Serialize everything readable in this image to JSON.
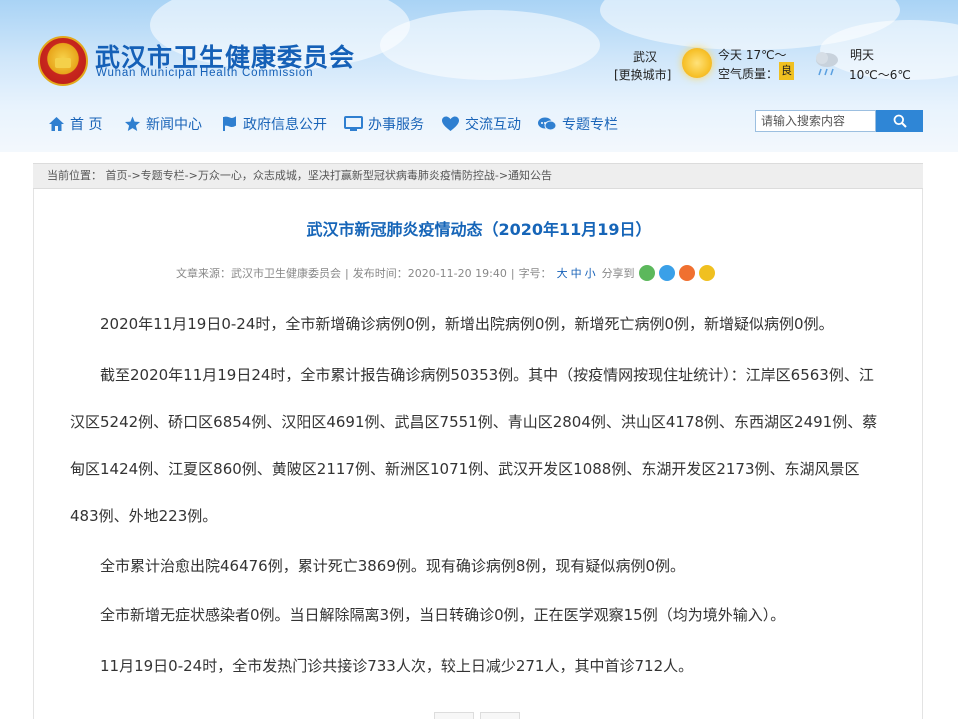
{
  "site": {
    "title": "武汉市卫生健康委员会",
    "subtitle": "Wuhan Municipal Health Commission"
  },
  "weather": {
    "city": "武汉",
    "switch_city": "[更换城市]",
    "today": "今天 17℃～",
    "aqi_label": "空气质量：",
    "aqi_value": "良",
    "tomorrow_label": "明天",
    "tomorrow_temp": "10℃～6℃",
    "colors": {
      "aqi_badge": "#f0c020"
    }
  },
  "nav": {
    "items": [
      {
        "label": "首 页",
        "icon": "home-icon"
      },
      {
        "label": "新闻中心",
        "icon": "star-icon"
      },
      {
        "label": "政府信息公开",
        "icon": "flag-icon"
      },
      {
        "label": "办事服务",
        "icon": "monitor-icon"
      },
      {
        "label": "交流互动",
        "icon": "heart-icon"
      },
      {
        "label": "专题专栏",
        "icon": "chat-icon"
      }
    ]
  },
  "search": {
    "placeholder": "请输入搜索内容",
    "button_icon": "search-icon"
  },
  "breadcrumb": {
    "text": "当前位置： 首页->专题专栏->万众一心，众志成城，坚决打赢新型冠状病毒肺炎疫情防控战->通知公告"
  },
  "article": {
    "title": "武汉市新冠肺炎疫情动态（2020年11月19日）",
    "meta": {
      "source_label": "文章来源：",
      "source": "武汉市卫生健康委员会",
      "sep": "|",
      "time_label": "发布时间：",
      "time": "2020-11-20 19:40",
      "size_label": "字号：",
      "size_large": "大",
      "size_medium": "中",
      "size_small": "小",
      "share_label": "分享到"
    },
    "paragraphs": {
      "p1": "2020年11月19日0-24时，全市新增确诊病例0例，新增出院病例0例，新增死亡病例0例，新增疑似病例0例。",
      "p2": "截至2020年11月19日24时，全市累计报告确诊病例50353例。其中（按疫情网按现住址统计）：江岸区6563例、江汉区5242例、硚口区6854例、汉阳区4691例、武昌区7551例、青山区2804例、洪山区4178例、东西湖区2491例、蔡甸区1424例、江夏区860例、黄陂区2117例、新洲区1071例、武汉开发区1088例、东湖开发区2173例、东湖风景区483例、外地223例。",
      "p3": "全市累计治愈出院46476例，累计死亡3869例。现有确诊病例8例，现有疑似病例0例。",
      "p4": "全市新增无症状感染者0例。当日解除隔离3例，当日转确诊0例，正在医学观察15例（均为境外输入）。",
      "p5": "11月19日0-24时，全市发热门诊共接诊733人次，较上日减少271人，其中首诊712人。"
    }
  },
  "colors": {
    "brand": "#1560b7",
    "title": "#1665b8",
    "search_button": "#2f86d6",
    "share": [
      "#5cb85c",
      "#3aa0e8",
      "#f07030",
      "#f0c020"
    ]
  }
}
